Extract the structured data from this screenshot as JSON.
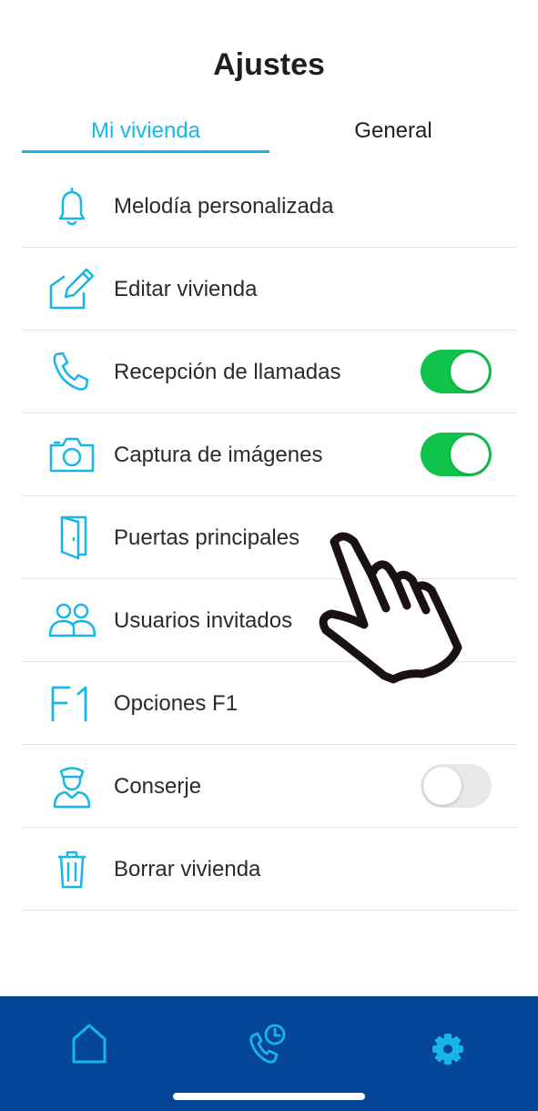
{
  "header": {
    "title": "Ajustes"
  },
  "tabs": [
    {
      "label": "Mi vivienda",
      "active": true
    },
    {
      "label": "General",
      "active": false
    }
  ],
  "colors": {
    "accent": "#17b6e9",
    "toggle_on": "#0fc34c",
    "toggle_off": "#e8e8ea",
    "bottom_bar": "#064698"
  },
  "settings": [
    {
      "icon": "bell-icon",
      "label": "Melodía personalizada"
    },
    {
      "icon": "edit-icon",
      "label": "Editar vivienda"
    },
    {
      "icon": "phone-icon",
      "label": "Recepción de llamadas",
      "toggle": true
    },
    {
      "icon": "camera-icon",
      "label": "Captura de imágenes",
      "toggle": true
    },
    {
      "icon": "door-icon",
      "label": "Puertas principales"
    },
    {
      "icon": "users-icon",
      "label": "Usuarios invitados"
    },
    {
      "icon": "f1-icon",
      "label": "Opciones F1"
    },
    {
      "icon": "concierge-icon",
      "label": "Conserje",
      "toggle": false
    },
    {
      "icon": "trash-icon",
      "label": "Borrar vivienda"
    }
  ],
  "bottom_nav": [
    {
      "icon": "home-icon",
      "active": false
    },
    {
      "icon": "call-history-icon",
      "active": false
    },
    {
      "icon": "settings-gear-icon",
      "active": true
    }
  ]
}
